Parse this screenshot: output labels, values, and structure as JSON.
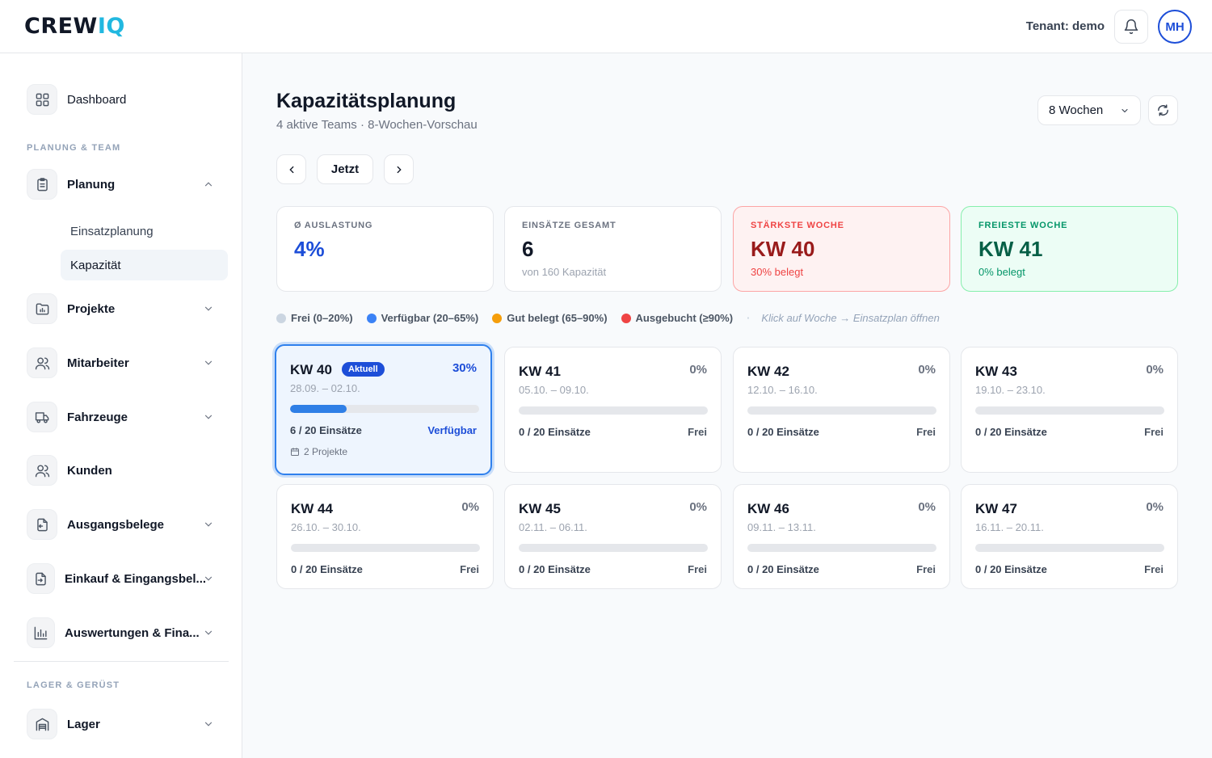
{
  "header": {
    "logo_main": "CREW",
    "logo_accent": "IQ",
    "tenant": "Tenant: demo",
    "avatar": "MH"
  },
  "sidebar": {
    "dashboard": "Dashboard",
    "section1": "PLANUNG & TEAM",
    "planung": "Planung",
    "sub_items": [
      "Einsatzplanung",
      "Kapazität"
    ],
    "active_sub": "Kapazität",
    "items": [
      "Projekte",
      "Mitarbeiter",
      "Fahrzeuge",
      "Kunden",
      "Ausgangsbelege",
      "Einkauf & Eingangsbel...",
      "Auswertungen & Fina..."
    ],
    "section2": "LAGER & GERÜST",
    "lager": "Lager"
  },
  "main": {
    "title": "Kapazitätsplanung",
    "subtitle": "4 aktive Teams · 8-Wochen-Vorschau",
    "range": "8 Wochen",
    "now_button": "Jetzt"
  },
  "stats": [
    {
      "label": "Ø AUSLASTUNG",
      "value": "4%",
      "note": ""
    },
    {
      "label": "EINSÄTZE GESAMT",
      "value": "6",
      "note": "von 160 Kapazität"
    },
    {
      "label": "STÄRKSTE WOCHE",
      "value": "KW 40",
      "note": "30% belegt"
    },
    {
      "label": "FREIESTE WOCHE",
      "value": "KW 41",
      "note": "0% belegt"
    }
  ],
  "legend": {
    "items": [
      {
        "label": "Frei (0–20%)",
        "color": "#cbd5e1"
      },
      {
        "label": "Verfügbar (20–65%)",
        "color": "#3b82f6"
      },
      {
        "label": "Gut belegt (65–90%)",
        "color": "#f59e0b"
      },
      {
        "label": "Ausgebucht (≥90%)",
        "color": "#ef4444"
      }
    ],
    "separator": "·",
    "hint": "Klick auf Woche → Einsatzplan öffnen"
  },
  "weeks": [
    {
      "kw": "KW 40",
      "badge": "Aktuell",
      "pct": "30%",
      "utilization": 0.3,
      "dates": "28.09. – 02.10.",
      "count": "6 / 20 Einsätze",
      "status": "Verfügbar",
      "projects": "2 Projekte"
    },
    {
      "kw": "KW 41",
      "pct": "0%",
      "utilization": 0,
      "dates": "05.10. – 09.10.",
      "count": "0 / 20 Einsätze",
      "status": "Frei"
    },
    {
      "kw": "KW 42",
      "pct": "0%",
      "utilization": 0,
      "dates": "12.10. – 16.10.",
      "count": "0 / 20 Einsätze",
      "status": "Frei"
    },
    {
      "kw": "KW 43",
      "pct": "0%",
      "utilization": 0,
      "dates": "19.10. – 23.10.",
      "count": "0 / 20 Einsätze",
      "status": "Frei"
    },
    {
      "kw": "KW 44",
      "pct": "0%",
      "utilization": 0,
      "dates": "26.10. – 30.10.",
      "count": "0 / 20 Einsätze",
      "status": "Frei"
    },
    {
      "kw": "KW 45",
      "pct": "0%",
      "utilization": 0,
      "dates": "02.11. – 06.11.",
      "count": "0 / 20 Einsätze",
      "status": "Frei"
    },
    {
      "kw": "KW 46",
      "pct": "0%",
      "utilization": 0,
      "dates": "09.11. – 13.11.",
      "count": "0 / 20 Einsätze",
      "status": "Frei"
    },
    {
      "kw": "KW 47",
      "pct": "0%",
      "utilization": 0,
      "dates": "16.11. – 20.11.",
      "count": "0 / 20 Einsätze",
      "status": "Frei"
    }
  ]
}
